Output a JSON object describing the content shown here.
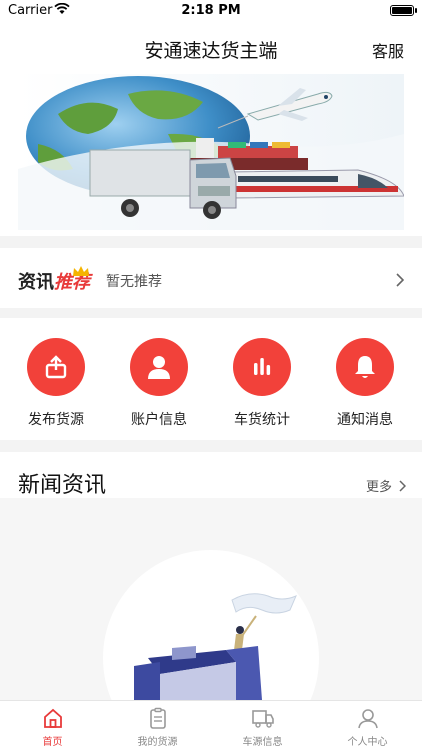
{
  "status_bar": {
    "carrier": "Carrier",
    "time": "2:18 PM"
  },
  "nav": {
    "title": "安通速达货主端",
    "service_label": "客服"
  },
  "recommend": {
    "brand_prefix": "资讯",
    "brand_highlight": "推荐",
    "text": "暂无推荐"
  },
  "quick_actions": [
    {
      "label": "发布货源",
      "icon": "upload-box-icon"
    },
    {
      "label": "账户信息",
      "icon": "user-icon"
    },
    {
      "label": "车货统计",
      "icon": "bar-chart-icon"
    },
    {
      "label": "通知消息",
      "icon": "bell-icon"
    }
  ],
  "news": {
    "title": "新闻资讯",
    "more_label": "更多"
  },
  "tab_bar": {
    "tabs": [
      {
        "label": "首页",
        "icon": "home-icon",
        "active": true
      },
      {
        "label": "我的货源",
        "icon": "clipboard-icon",
        "active": false
      },
      {
        "label": "车源信息",
        "icon": "truck-icon",
        "active": false
      },
      {
        "label": "个人中心",
        "icon": "person-icon",
        "active": false
      }
    ]
  },
  "colors": {
    "accent": "#f2413a",
    "active_tab": "#e83a3a",
    "divider": "#f3f3f3"
  }
}
